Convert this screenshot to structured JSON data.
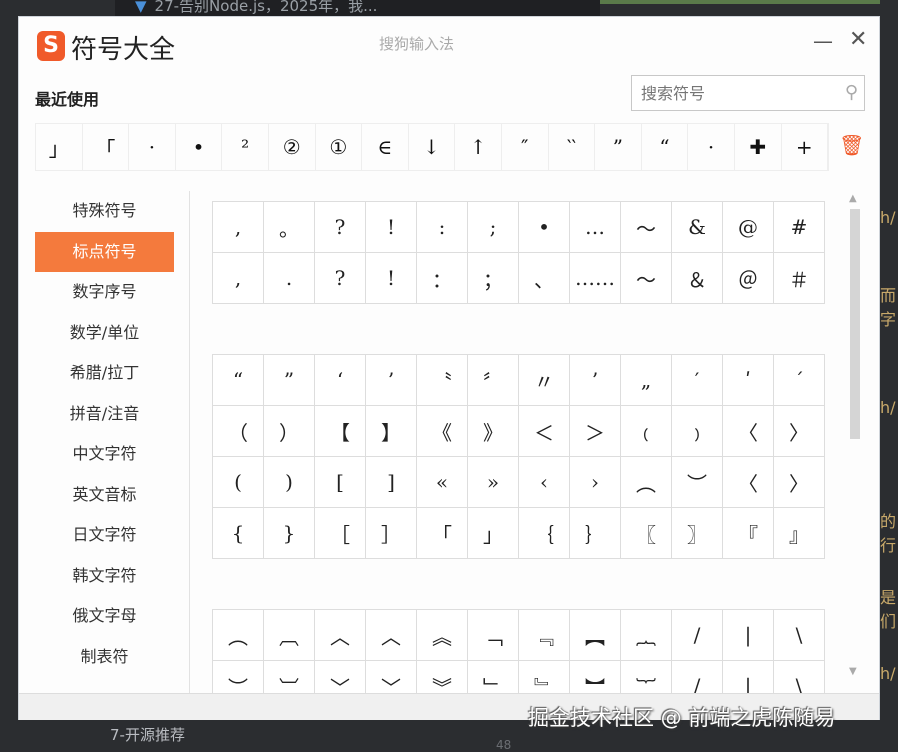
{
  "background": {
    "tab_title": "27-告别Node.js，2025年，我...",
    "bottom_item": "7-开源推荐",
    "line_number": "48",
    "right_fragments": [
      "h/",
      "而字",
      "h/",
      "的行",
      "是们",
      "h/"
    ]
  },
  "window": {
    "logo_letter": "S",
    "title": "符号大全",
    "subtitle": "搜狗输入法",
    "minimize": "—",
    "close": "✕"
  },
  "recent": {
    "label": "最近使用",
    "symbols": [
      "」",
      "「",
      "·",
      "•",
      "²",
      "②",
      "①",
      "∈",
      "↓",
      "↑",
      "″",
      "‵‵",
      "”",
      "“",
      "·",
      "✚",
      "+"
    ]
  },
  "search": {
    "placeholder": "搜索符号",
    "icon": "search-icon"
  },
  "sidebar": {
    "items": [
      "特殊符号",
      "标点符号",
      "数字序号",
      "数学/单位",
      "希腊/拉丁",
      "拼音/注音",
      "中文字符",
      "英文音标",
      "日文字符",
      "韩文字符",
      "俄文字母",
      "制表符"
    ],
    "active": 1
  },
  "groups": [
    [
      ",",
      "。",
      "?",
      "!",
      ":",
      ";",
      "•",
      "…",
      "～",
      "&",
      "@",
      "#",
      ",",
      ".",
      "?",
      "!",
      "：",
      "；",
      "、",
      "……",
      "～",
      "＆",
      "＠",
      "＃"
    ],
    [
      "“",
      "”",
      "‘",
      "’",
      "〝",
      "〞",
      "〃",
      "’",
      "„",
      "′",
      "ʹ",
      "ˊ",
      "（",
      "）",
      "【",
      "】",
      "《",
      "》",
      "＜",
      "＞",
      "﹙",
      "﹚",
      "〈",
      "〉",
      "(",
      ")",
      "[",
      "]",
      "«",
      "»",
      "‹",
      "›",
      "︵",
      "︶",
      "〈",
      "〉",
      "{",
      "}",
      "［",
      "］",
      "「",
      "」",
      "｛",
      "｝",
      "〖",
      "〗",
      "『",
      "』"
    ],
    [
      "︵",
      "︹",
      "︿",
      "︿",
      "︽",
      "﹁",
      "﹃",
      "︻",
      "︷",
      "/",
      "|",
      "\\",
      "︶",
      "︺",
      "﹀",
      "﹀",
      "︾",
      "﹂",
      "﹄",
      "︼",
      "︸",
      "/",
      "|",
      "\\"
    ]
  ],
  "watermark": "掘金技术社区 @ 前端之虎陈随易"
}
